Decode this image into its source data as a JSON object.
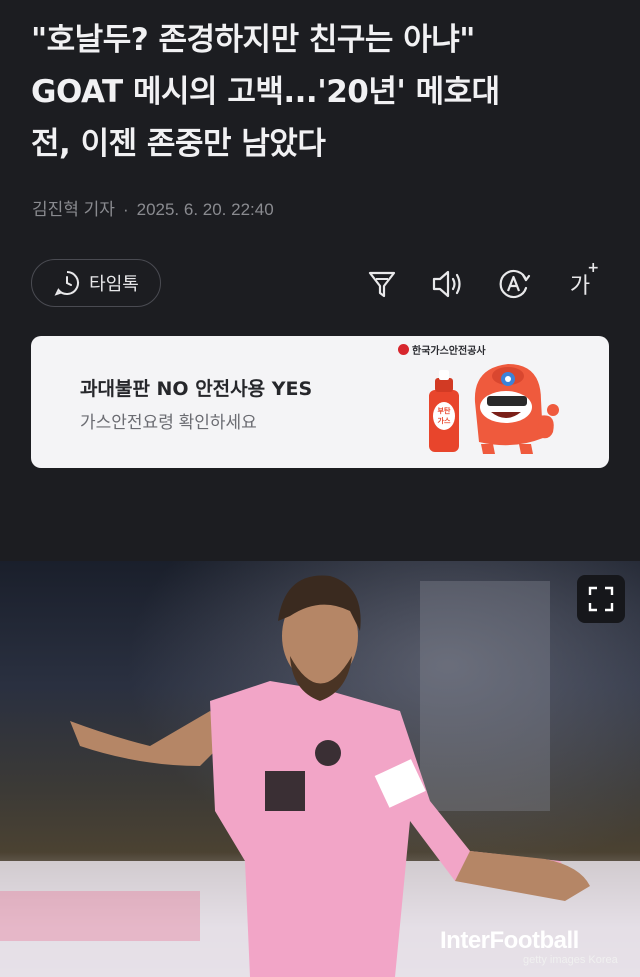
{
  "article": {
    "headline_line1": "\"호날두? 존경하지만 친구는 아냐\"",
    "headline_line2": "GOAT 메시의 고백...'20년' 메호대",
    "headline_line3": "전, 이젠 존중만 남았다",
    "author": "김진혁 기자",
    "separator": "·",
    "datetime": "2025. 6. 20. 22:40"
  },
  "toolbar": {
    "timetalk_label": "타임톡",
    "icons": [
      "clock-chat-icon",
      "summary-icon",
      "speaker-icon",
      "translate-icon",
      "font-size-icon"
    ],
    "font_size_label": "가"
  },
  "ad": {
    "title": "과대불판 NO 안전사용 YES",
    "subtitle": "가스안전요령 확인하세요",
    "sponsor": "한국가스안전공사",
    "can_label": "부탄가스"
  },
  "photo": {
    "watermark": "InterFootball",
    "credit": "getty images Korea"
  },
  "colors": {
    "background": "#1c1d21",
    "ad_background": "#f4f4f6",
    "accent_red": "#e8452c"
  }
}
